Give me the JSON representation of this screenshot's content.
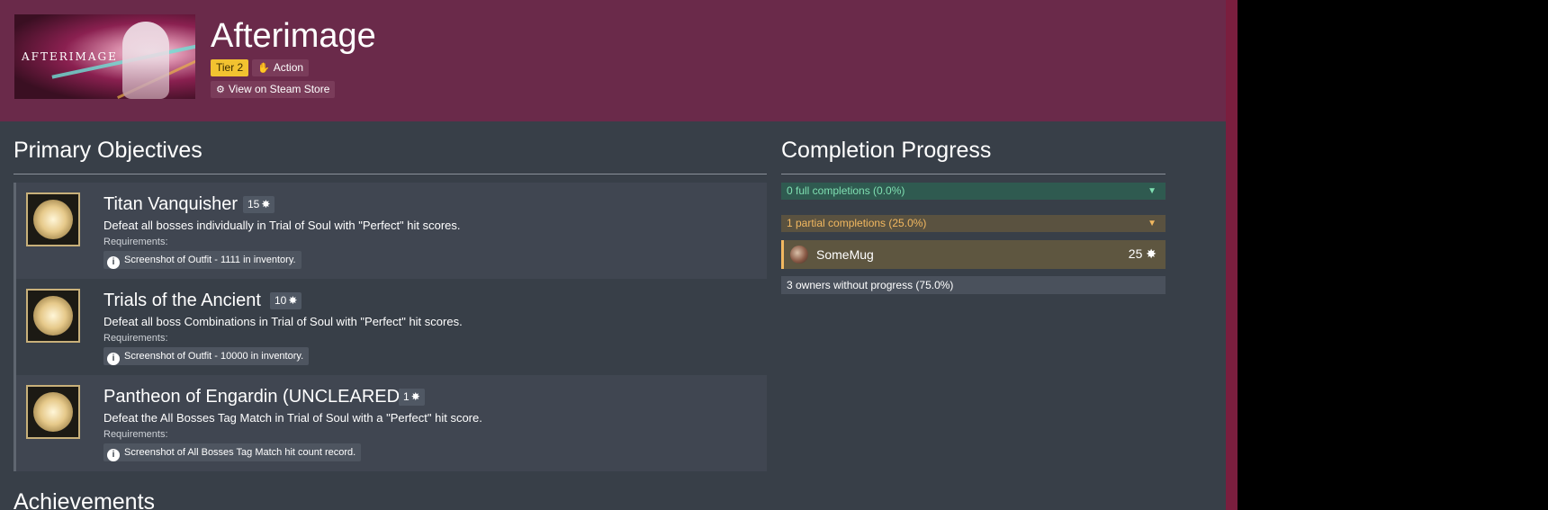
{
  "game": {
    "title": "Afterimage",
    "cover_logo": "AFTERIMAGE",
    "tier_label": "Tier 2",
    "genre_label": "Action",
    "steam_label": "View on Steam Store"
  },
  "objectives": {
    "heading": "Primary Objectives",
    "items": [
      {
        "name": "Titan Vanquisher",
        "points": "15",
        "description": "Defeat all bosses individually in Trial of Soul with \"Perfect\" hit scores.",
        "requirements_label": "Requirements:",
        "requirement": "Screenshot of Outfit - 1111 in inventory."
      },
      {
        "name": "Trials of the Ancient",
        "points": "10",
        "description": "Defeat all boss Combinations in Trial of Soul with \"Perfect\" hit scores.",
        "requirements_label": "Requirements:",
        "requirement": "Screenshot of Outfit - 10000 in inventory."
      },
      {
        "name": "Pantheon of Engardin (UNCLEARED)",
        "points": "1",
        "description": "Defeat the All Bosses Tag Match in Trial of Soul with a \"Perfect\" hit score.",
        "requirements_label": "Requirements:",
        "requirement": "Screenshot of All Bosses Tag Match hit count record."
      }
    ]
  },
  "achievements": {
    "heading": "Achievements"
  },
  "progress": {
    "heading": "Completion Progress",
    "full_label": "0 full completions (0.0%)",
    "partial_label": "1 partial completions (25.0%)",
    "user": {
      "name": "SomeMug",
      "points": "25"
    },
    "none_label": "3 owners without progress (75.0%)"
  },
  "colors": {
    "header_bg": "#6a2a4a",
    "page_bg": "#383f48",
    "tier_badge": "#f2c230",
    "full_completion": "#7fe0b2",
    "partial_completion": "#f2b860"
  },
  "icons": {
    "genre": "hand-icon",
    "steam": "steam-icon",
    "points": "star-icon",
    "requirement": "info-icon",
    "dropdown": "caret-down-icon"
  }
}
